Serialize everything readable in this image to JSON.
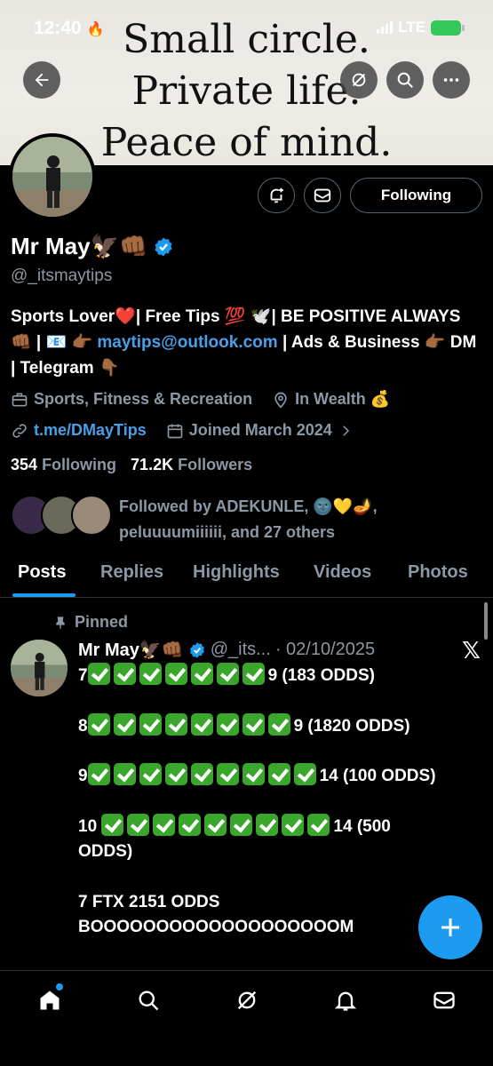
{
  "status_bar": {
    "time": "12:40",
    "network": "LTE"
  },
  "banner": {
    "lines": [
      "Small circle.",
      "Private life.",
      "Peace of mind."
    ]
  },
  "profile": {
    "name": "Mr May🦅👊🏾",
    "handle": "@_itsmaytips",
    "following_button": "Following",
    "bio": {
      "part1": "Sports Lover❤️| Free Tips 💯 🕊️| BE POSITIVE ALWAYS 👊🏾 | 📧 👉🏾 ",
      "email": "maytips@outlook.com",
      "part2": " | Ads & Business 👉🏾 DM | Telegram 👇🏾"
    },
    "category": "Sports, Fitness & Recreation",
    "location": "In Wealth 💰",
    "website": "t.me/DMayTips",
    "joined": "Joined March 2024",
    "following_count": "354",
    "following_label": "Following",
    "followers_count": "71.2K",
    "followers_label": "Followers",
    "followed_by": "Followed by ADEKUNLE, 🌚💛🪔, peluuuumiiiiii, and 27 others"
  },
  "tabs": [
    "Posts",
    "Replies",
    "Highlights",
    "Videos",
    "Photos"
  ],
  "active_tab": "Posts",
  "pinned_tweet": {
    "pinned_label": "Pinned",
    "author": "Mr May🦅👊🏾",
    "handle": "@_its...",
    "date": "· 02/10/2025",
    "lines": [
      {
        "prefix": "7",
        "checks": 7,
        "suffix": "9 (183 ODDS)"
      },
      {
        "prefix": "8",
        "checks": 8,
        "suffix": "9 (1820 ODDS)"
      },
      {
        "prefix": "9",
        "checks": 9,
        "suffix": "14 (100 ODDS)"
      },
      {
        "prefix": "10 ",
        "checks": 9,
        "suffix": "14 (500"
      }
    ],
    "line4_cont": "ODDS)",
    "line5": "7 FTX 2151 ODDS",
    "line6": "BOOOOOOOOOOOOOOOOOOOM"
  },
  "bottom_nav": [
    "home-icon",
    "search-icon",
    "grok-icon",
    "notifications-icon",
    "messages-icon"
  ],
  "colors": {
    "accent": "#1d9bf0",
    "link": "#4a9fe9",
    "check": "#3aa62c"
  }
}
